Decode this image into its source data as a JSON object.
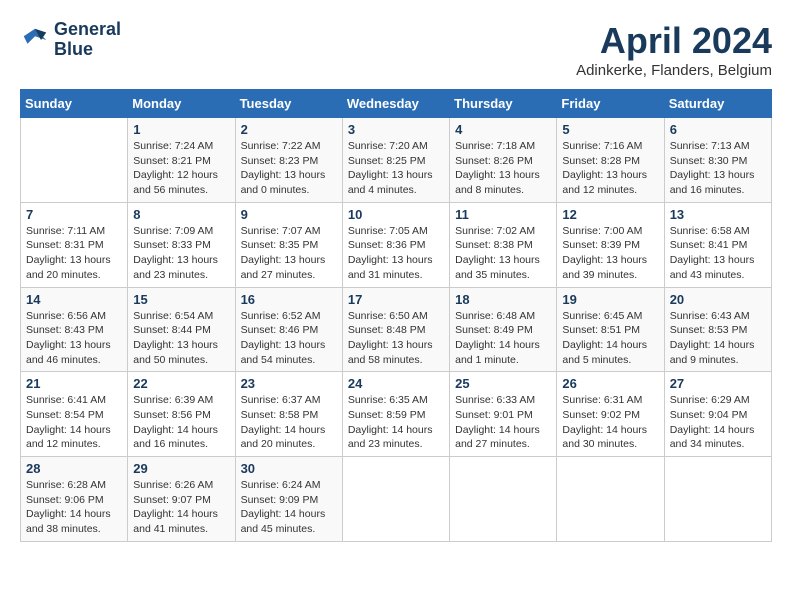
{
  "header": {
    "logo_line1": "General",
    "logo_line2": "Blue",
    "month_year": "April 2024",
    "location": "Adinkerke, Flanders, Belgium"
  },
  "weekdays": [
    "Sunday",
    "Monday",
    "Tuesday",
    "Wednesday",
    "Thursday",
    "Friday",
    "Saturday"
  ],
  "weeks": [
    [
      {
        "day": "",
        "info": ""
      },
      {
        "day": "1",
        "info": "Sunrise: 7:24 AM\nSunset: 8:21 PM\nDaylight: 12 hours\nand 56 minutes."
      },
      {
        "day": "2",
        "info": "Sunrise: 7:22 AM\nSunset: 8:23 PM\nDaylight: 13 hours\nand 0 minutes."
      },
      {
        "day": "3",
        "info": "Sunrise: 7:20 AM\nSunset: 8:25 PM\nDaylight: 13 hours\nand 4 minutes."
      },
      {
        "day": "4",
        "info": "Sunrise: 7:18 AM\nSunset: 8:26 PM\nDaylight: 13 hours\nand 8 minutes."
      },
      {
        "day": "5",
        "info": "Sunrise: 7:16 AM\nSunset: 8:28 PM\nDaylight: 13 hours\nand 12 minutes."
      },
      {
        "day": "6",
        "info": "Sunrise: 7:13 AM\nSunset: 8:30 PM\nDaylight: 13 hours\nand 16 minutes."
      }
    ],
    [
      {
        "day": "7",
        "info": "Sunrise: 7:11 AM\nSunset: 8:31 PM\nDaylight: 13 hours\nand 20 minutes."
      },
      {
        "day": "8",
        "info": "Sunrise: 7:09 AM\nSunset: 8:33 PM\nDaylight: 13 hours\nand 23 minutes."
      },
      {
        "day": "9",
        "info": "Sunrise: 7:07 AM\nSunset: 8:35 PM\nDaylight: 13 hours\nand 27 minutes."
      },
      {
        "day": "10",
        "info": "Sunrise: 7:05 AM\nSunset: 8:36 PM\nDaylight: 13 hours\nand 31 minutes."
      },
      {
        "day": "11",
        "info": "Sunrise: 7:02 AM\nSunset: 8:38 PM\nDaylight: 13 hours\nand 35 minutes."
      },
      {
        "day": "12",
        "info": "Sunrise: 7:00 AM\nSunset: 8:39 PM\nDaylight: 13 hours\nand 39 minutes."
      },
      {
        "day": "13",
        "info": "Sunrise: 6:58 AM\nSunset: 8:41 PM\nDaylight: 13 hours\nand 43 minutes."
      }
    ],
    [
      {
        "day": "14",
        "info": "Sunrise: 6:56 AM\nSunset: 8:43 PM\nDaylight: 13 hours\nand 46 minutes."
      },
      {
        "day": "15",
        "info": "Sunrise: 6:54 AM\nSunset: 8:44 PM\nDaylight: 13 hours\nand 50 minutes."
      },
      {
        "day": "16",
        "info": "Sunrise: 6:52 AM\nSunset: 8:46 PM\nDaylight: 13 hours\nand 54 minutes."
      },
      {
        "day": "17",
        "info": "Sunrise: 6:50 AM\nSunset: 8:48 PM\nDaylight: 13 hours\nand 58 minutes."
      },
      {
        "day": "18",
        "info": "Sunrise: 6:48 AM\nSunset: 8:49 PM\nDaylight: 14 hours\nand 1 minute."
      },
      {
        "day": "19",
        "info": "Sunrise: 6:45 AM\nSunset: 8:51 PM\nDaylight: 14 hours\nand 5 minutes."
      },
      {
        "day": "20",
        "info": "Sunrise: 6:43 AM\nSunset: 8:53 PM\nDaylight: 14 hours\nand 9 minutes."
      }
    ],
    [
      {
        "day": "21",
        "info": "Sunrise: 6:41 AM\nSunset: 8:54 PM\nDaylight: 14 hours\nand 12 minutes."
      },
      {
        "day": "22",
        "info": "Sunrise: 6:39 AM\nSunset: 8:56 PM\nDaylight: 14 hours\nand 16 minutes."
      },
      {
        "day": "23",
        "info": "Sunrise: 6:37 AM\nSunset: 8:58 PM\nDaylight: 14 hours\nand 20 minutes."
      },
      {
        "day": "24",
        "info": "Sunrise: 6:35 AM\nSunset: 8:59 PM\nDaylight: 14 hours\nand 23 minutes."
      },
      {
        "day": "25",
        "info": "Sunrise: 6:33 AM\nSunset: 9:01 PM\nDaylight: 14 hours\nand 27 minutes."
      },
      {
        "day": "26",
        "info": "Sunrise: 6:31 AM\nSunset: 9:02 PM\nDaylight: 14 hours\nand 30 minutes."
      },
      {
        "day": "27",
        "info": "Sunrise: 6:29 AM\nSunset: 9:04 PM\nDaylight: 14 hours\nand 34 minutes."
      }
    ],
    [
      {
        "day": "28",
        "info": "Sunrise: 6:28 AM\nSunset: 9:06 PM\nDaylight: 14 hours\nand 38 minutes."
      },
      {
        "day": "29",
        "info": "Sunrise: 6:26 AM\nSunset: 9:07 PM\nDaylight: 14 hours\nand 41 minutes."
      },
      {
        "day": "30",
        "info": "Sunrise: 6:24 AM\nSunset: 9:09 PM\nDaylight: 14 hours\nand 45 minutes."
      },
      {
        "day": "",
        "info": ""
      },
      {
        "day": "",
        "info": ""
      },
      {
        "day": "",
        "info": ""
      },
      {
        "day": "",
        "info": ""
      }
    ]
  ]
}
